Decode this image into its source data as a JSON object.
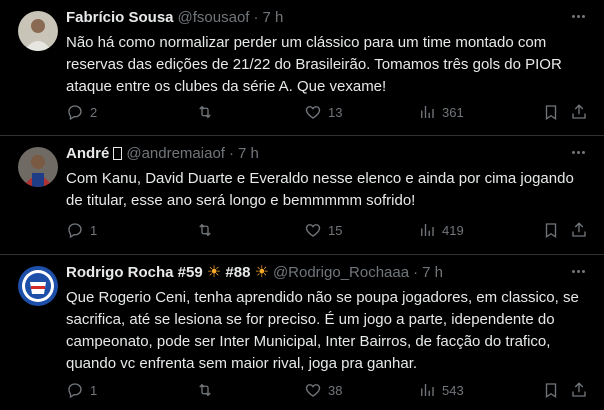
{
  "tweets": [
    {
      "name": "Fabrício Sousa",
      "handle": "@fsousaof",
      "time": "7 h",
      "text": "Não há como normalizar perder um clássico para um time montado com reservas das edições de 21/22 do Brasileirão. Tomamos três gols do PIOR ataque entre os clubes da série A. Que vexame!",
      "replies": "2",
      "retweets": "",
      "likes": "13",
      "views": "361"
    },
    {
      "name": "André",
      "name_glyph": "□",
      "handle": "@andremaiaof",
      "time": "7 h",
      "text": "Com Kanu, David Duarte e Everaldo nesse elenco e ainda por cima jogando de titular, esse ano será longo e bemmmmm sofrido!",
      "replies": "1",
      "retweets": "",
      "likes": "15",
      "views": "419"
    },
    {
      "name_part1": "Rodrigo Rocha #59",
      "name_part2": "#88",
      "handle": "@Rodrigo_Rochaaa",
      "time": "7 h",
      "text": "Que Rogerio Ceni, tenha aprendido não se poupa jogadores, em classico, se sacrifica, até se lesiona se for preciso. É um jogo a parte, idependente do campeonato, pode ser Inter Municipal, Inter Bairros, de facção do trafico, quando vc enfrenta sem maior rival, joga pra ganhar.",
      "replies": "1",
      "retweets": "",
      "likes": "38",
      "views": "543"
    }
  ],
  "icons": {
    "reply": "reply-icon",
    "retweet": "retweet-icon",
    "like": "heart-icon",
    "views": "views-chart-icon",
    "bookmark": "bookmark-icon",
    "share": "share-icon",
    "more": "more-icon",
    "sun": "sun-emoji-icon"
  },
  "colors": {
    "background": "#000000",
    "text": "#e7e9ea",
    "secondary": "#71767b",
    "divider": "#2f3336",
    "sun": "#f7a928"
  }
}
